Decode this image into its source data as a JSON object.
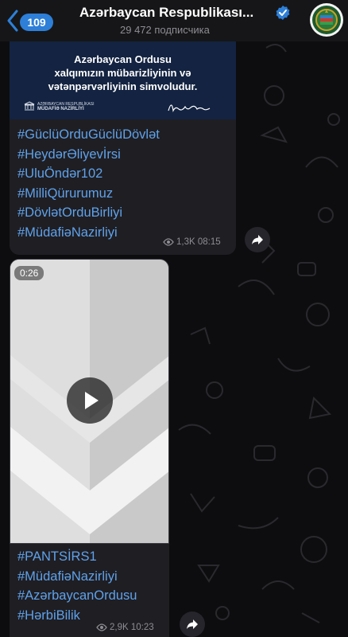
{
  "header": {
    "unread_count": "109",
    "channel_title": "Azərbaycan Respublikası...",
    "subscribers": "29 472 подписчика",
    "accent_color": "#2d7fd8"
  },
  "messages": [
    {
      "image_lines": [
        "Azərbaycan Ordusu",
        "xalqımızın mübarizliyinin və",
        "vətənpərvərliyinin simvoludur."
      ],
      "ministry_lines": [
        "AZƏRBAYCAN RESPUBLİKASI",
        "MÜDAFİƏ NAZİRLİYİ"
      ],
      "tags": [
        "#GüclüOrduGüclüDövlət",
        "#HeydərƏliyevİrsi",
        "#UluÖndər102",
        "#MilliQürurumuz",
        "#DövlətOrduBirliyi",
        "#MüdafiəNazirliyi"
      ],
      "views": "1,3K",
      "time": "08:15"
    },
    {
      "duration": "0:26",
      "tags": [
        "#PANTSİRS1",
        "#MüdafiəNazirliyi",
        "#AzərbaycanOrdusu",
        "#HərbiBilik"
      ],
      "views": "2,9K",
      "time": "10:23"
    }
  ],
  "colors": {
    "link": "#5fa2ea",
    "bubble": "#1f1e23",
    "background": "#0d0d0f"
  },
  "icons": [
    "back-chevron-icon",
    "verified-icon",
    "eye-icon",
    "share-arrow-icon",
    "play-icon"
  ]
}
